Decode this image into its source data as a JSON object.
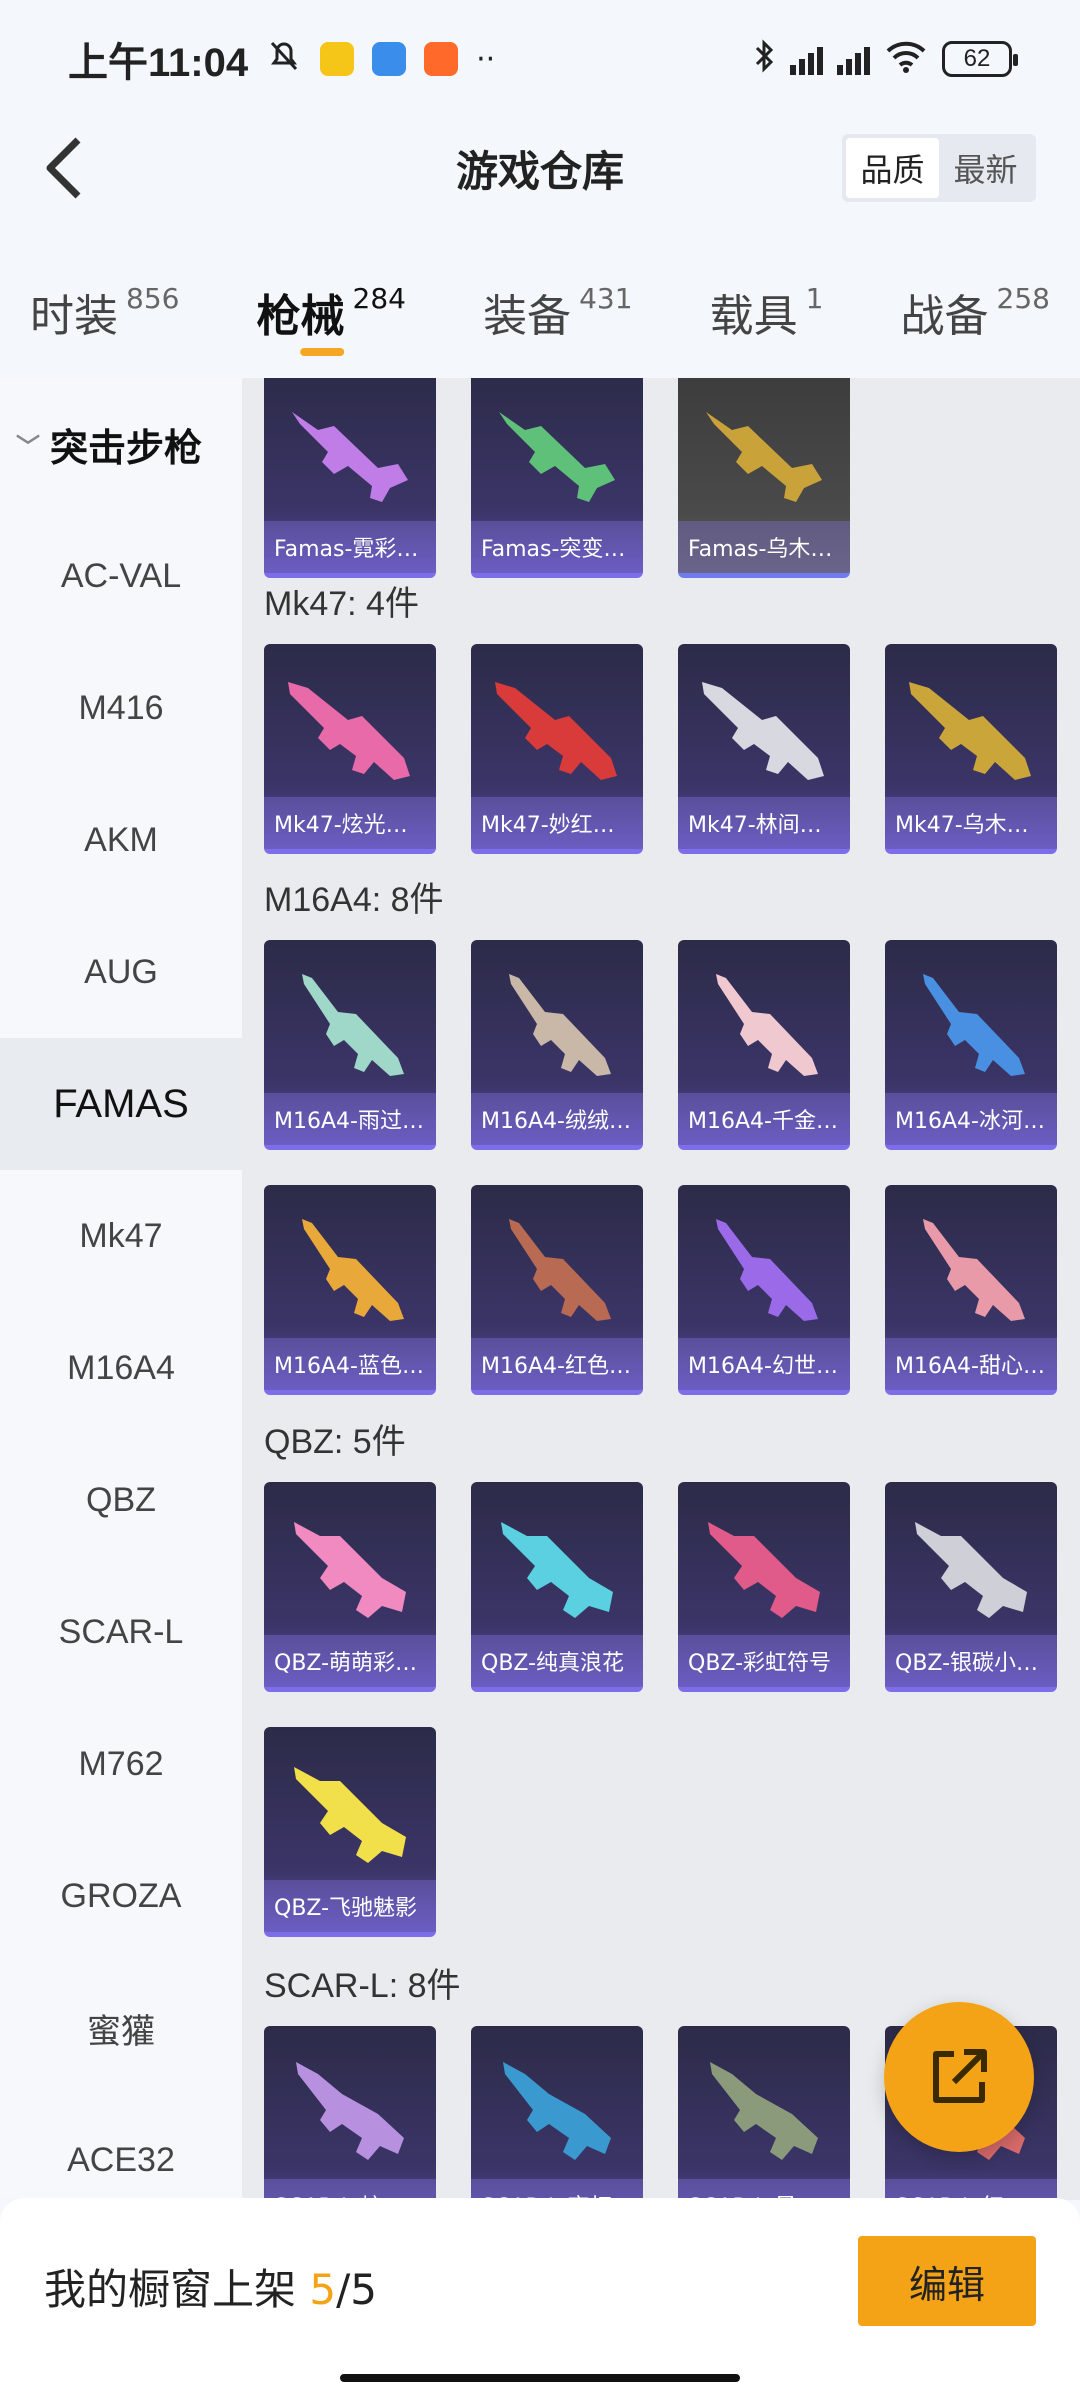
{
  "status_bar": {
    "time": "上午11:04",
    "battery": "62"
  },
  "header": {
    "title": "游戏仓库",
    "sort_options": [
      "品质",
      "最新"
    ],
    "sort_active": "品质"
  },
  "tabs": [
    {
      "label": "时装",
      "count": "856"
    },
    {
      "label": "枪械",
      "count": "284",
      "active": true
    },
    {
      "label": "装备",
      "count": "431"
    },
    {
      "label": "载具",
      "count": "1"
    },
    {
      "label": "战备",
      "count": "258"
    }
  ],
  "sidebar": {
    "group": "突击步枪",
    "items": [
      "AC-VAL",
      "M416",
      "AKM",
      "AUG",
      "FAMAS",
      "Mk47",
      "M16A4",
      "QBZ",
      "SCAR-L",
      "M762",
      "GROZA",
      "蜜獾",
      "ACE32"
    ],
    "active": "FAMAS"
  },
  "sections": {
    "famas": {
      "items": [
        "Famas-霓彩…",
        "Famas-突变…",
        "Famas-乌木…"
      ]
    },
    "mk47": {
      "title": "Mk47: 4件",
      "items": [
        "Mk47-炫光…",
        "Mk47-妙红…",
        "Mk47-林间…",
        "Mk47-乌木…"
      ]
    },
    "m16a4": {
      "title": "M16A4: 8件",
      "items": [
        "M16A4-雨过…",
        "M16A4-绒绒…",
        "M16A4-千金…",
        "M16A4-冰河…",
        "M16A4-蓝色…",
        "M16A4-红色…",
        "M16A4-幻世…",
        "M16A4-甜心…"
      ]
    },
    "qbz": {
      "title": "QBZ: 5件",
      "items": [
        "QBZ-萌萌彩…",
        "QBZ-纯真浪花",
        "QBZ-彩虹符号",
        "QBZ-银碳小…",
        "QBZ-飞驰魅影"
      ]
    },
    "scarl": {
      "title": "SCAR-L: 8件",
      "items": [
        "SCAR-L-炫…",
        "SCAR-L-夜灯…",
        "SCAR-L-星…",
        "SCAR-L-红…"
      ]
    }
  },
  "bottom": {
    "shelf_label": "我的橱窗上架",
    "shelf_current": "5",
    "shelf_sep": "/",
    "shelf_total": "5",
    "edit_label": "编辑"
  },
  "colors": {
    "accent": "#f5a316",
    "card_bg": "#3b3568",
    "card_border": "#7c6ee8"
  }
}
